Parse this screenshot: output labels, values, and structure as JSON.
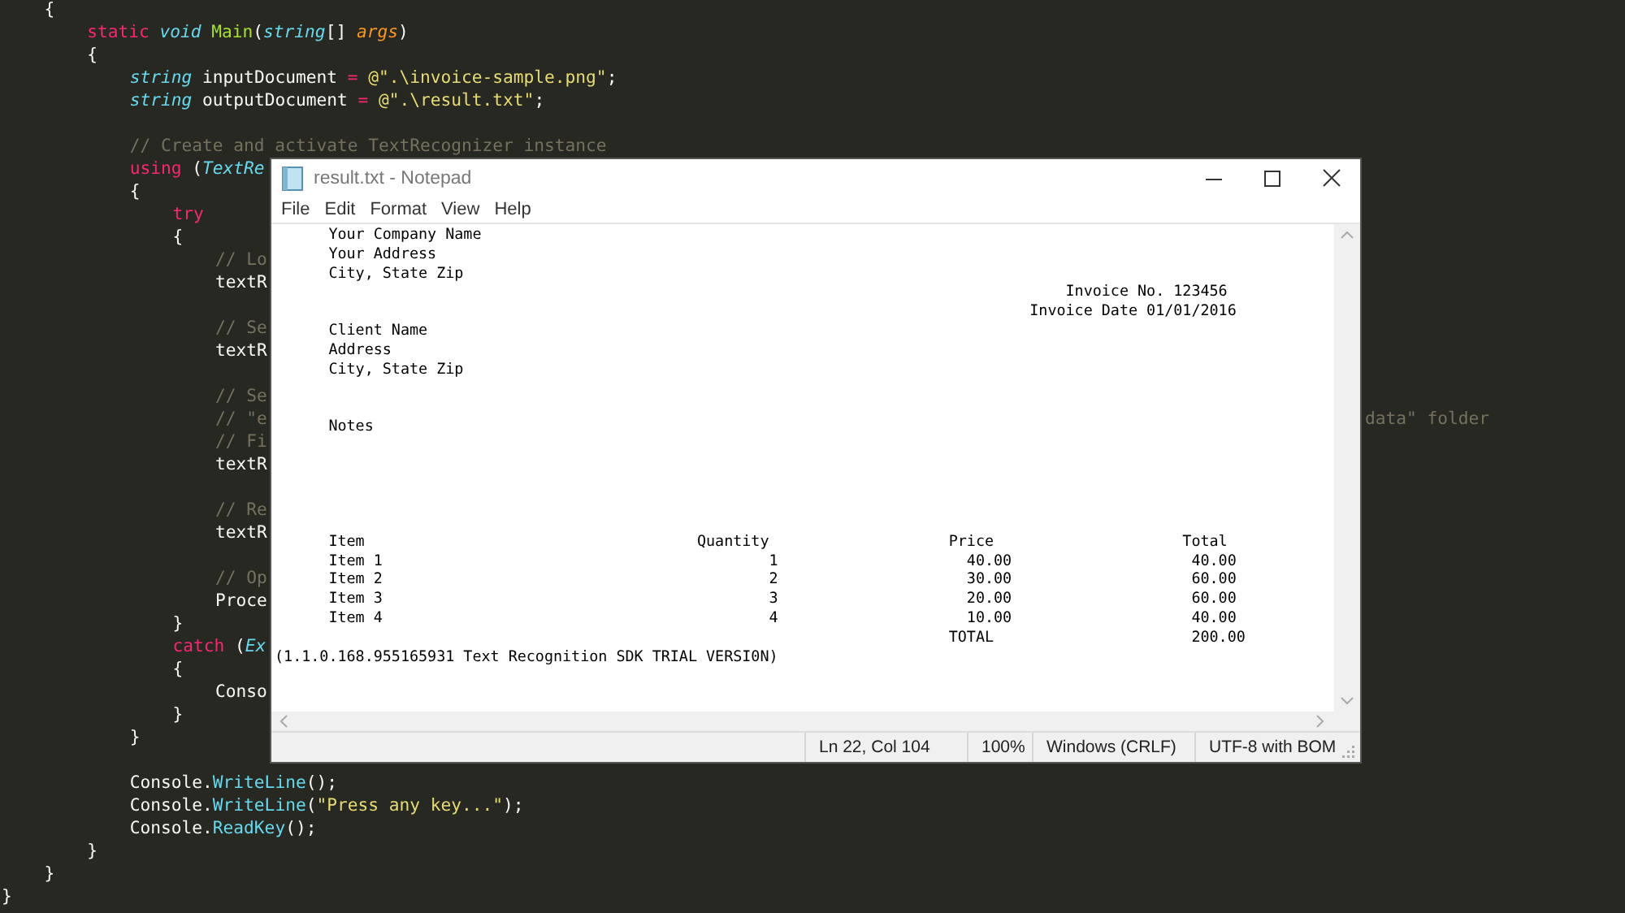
{
  "editor": {
    "lines": [
      {
        "kind": "block",
        "children": [
          {
            "kind": "code",
            "tokens": [
              {
                "kind": "plain",
                "text": "{"
              }
            ]
          },
          {
            "kind": "block",
            "children": [
              {
                "kind": "code",
                "tokens": [
                  {
                    "kind": "keyword",
                    "text": "static"
                  },
                  {
                    "kind": "type",
                    "text": " void"
                  },
                  {
                    "kind": "func",
                    "text": " Main"
                  },
                  {
                    "kind": "plain",
                    "text": "("
                  },
                  {
                    "kind": "type",
                    "text": "string"
                  },
                  {
                    "kind": "plain",
                    "text": "[] "
                  },
                  {
                    "kind": "param",
                    "text": "args"
                  },
                  {
                    "kind": "plain",
                    "text": ")"
                  }
                ]
              },
              {
                "kind": "code",
                "tokens": [
                  {
                    "kind": "plain",
                    "text": "{"
                  }
                ]
              },
              {
                "kind": "block",
                "children": [
                  {
                    "kind": "code",
                    "tokens": [
                      {
                        "kind": "type",
                        "text": "string"
                      },
                      {
                        "kind": "plain",
                        "text": " inputDocument "
                      },
                      {
                        "kind": "keyword",
                        "text": "="
                      },
                      {
                        "kind": "string",
                        "text": " @\".\\invoice-sample.png\""
                      },
                      {
                        "kind": "plain",
                        "text": ";"
                      }
                    ]
                  },
                  {
                    "kind": "code",
                    "tokens": [
                      {
                        "kind": "type",
                        "text": "string"
                      },
                      {
                        "kind": "plain",
                        "text": " outputDocument "
                      },
                      {
                        "kind": "keyword",
                        "text": "="
                      },
                      {
                        "kind": "string",
                        "text": " @\".\\result.txt\""
                      },
                      {
                        "kind": "plain",
                        "text": ";"
                      }
                    ]
                  },
                  {
                    "kind": "blank"
                  },
                  {
                    "kind": "code",
                    "tokens": [
                      {
                        "kind": "comment",
                        "text": "// Create and activate TextRecognizer instance"
                      }
                    ]
                  },
                  {
                    "kind": "code",
                    "tokens": [
                      {
                        "kind": "keyword",
                        "text": "using"
                      },
                      {
                        "kind": "plain",
                        "text": " ("
                      },
                      {
                        "kind": "type",
                        "text": "TextRe"
                      }
                    ]
                  },
                  {
                    "kind": "code",
                    "tokens": [
                      {
                        "kind": "plain",
                        "text": "{"
                      }
                    ]
                  },
                  {
                    "kind": "block",
                    "children": [
                      {
                        "kind": "code",
                        "tokens": [
                          {
                            "kind": "keyword",
                            "text": "try"
                          }
                        ]
                      },
                      {
                        "kind": "code",
                        "tokens": [
                          {
                            "kind": "plain",
                            "text": "{"
                          }
                        ]
                      },
                      {
                        "kind": "block",
                        "children": [
                          {
                            "kind": "code",
                            "tokens": [
                              {
                                "kind": "comment",
                                "text": "// Lo"
                              }
                            ]
                          },
                          {
                            "kind": "code",
                            "tokens": [
                              {
                                "kind": "plain",
                                "text": "textR"
                              }
                            ]
                          },
                          {
                            "kind": "blank"
                          },
                          {
                            "kind": "code",
                            "tokens": [
                              {
                                "kind": "comment",
                                "text": "// Se"
                              }
                            ]
                          },
                          {
                            "kind": "code",
                            "tokens": [
                              {
                                "kind": "plain",
                                "text": "textR"
                              }
                            ]
                          },
                          {
                            "kind": "blank"
                          },
                          {
                            "kind": "code",
                            "tokens": [
                              {
                                "kind": "comment",
                                "text": "// Se"
                              }
                            ]
                          },
                          {
                            "kind": "code",
                            "tokens": [
                              {
                                "kind": "comment",
                                "text": "// \"e"
                              }
                            ],
                            "tail": "data\" folder"
                          },
                          {
                            "kind": "code",
                            "tokens": [
                              {
                                "kind": "comment",
                                "text": "// Fi"
                              }
                            ]
                          },
                          {
                            "kind": "code",
                            "tokens": [
                              {
                                "kind": "plain",
                                "text": "textR"
                              }
                            ]
                          },
                          {
                            "kind": "blank"
                          },
                          {
                            "kind": "code",
                            "tokens": [
                              {
                                "kind": "comment",
                                "text": "// Re"
                              }
                            ]
                          },
                          {
                            "kind": "code",
                            "tokens": [
                              {
                                "kind": "plain",
                                "text": "textR"
                              }
                            ]
                          },
                          {
                            "kind": "blank"
                          },
                          {
                            "kind": "code",
                            "tokens": [
                              {
                                "kind": "comment",
                                "text": "// Op"
                              }
                            ]
                          },
                          {
                            "kind": "code",
                            "tokens": [
                              {
                                "kind": "plain",
                                "text": "Proce"
                              }
                            ]
                          }
                        ]
                      },
                      {
                        "kind": "code",
                        "tokens": [
                          {
                            "kind": "plain",
                            "text": "}"
                          }
                        ]
                      },
                      {
                        "kind": "code",
                        "tokens": [
                          {
                            "kind": "keyword",
                            "text": "catch"
                          },
                          {
                            "kind": "plain",
                            "text": " ("
                          },
                          {
                            "kind": "type",
                            "text": "Ex"
                          }
                        ]
                      },
                      {
                        "kind": "code",
                        "tokens": [
                          {
                            "kind": "plain",
                            "text": "{"
                          }
                        ]
                      },
                      {
                        "kind": "block",
                        "children": [
                          {
                            "kind": "code",
                            "tokens": [
                              {
                                "kind": "plain",
                                "text": "Conso"
                              }
                            ]
                          }
                        ]
                      },
                      {
                        "kind": "code",
                        "tokens": [
                          {
                            "kind": "plain",
                            "text": "}"
                          }
                        ]
                      }
                    ]
                  },
                  {
                    "kind": "code",
                    "tokens": [
                      {
                        "kind": "plain",
                        "text": "}"
                      }
                    ]
                  },
                  {
                    "kind": "blank"
                  },
                  {
                    "kind": "code",
                    "tokens": [
                      {
                        "kind": "plain",
                        "text": "Console."
                      },
                      {
                        "kind": "method",
                        "text": "WriteLine"
                      },
                      {
                        "kind": "plain",
                        "text": "();"
                      }
                    ]
                  },
                  {
                    "kind": "code",
                    "tokens": [
                      {
                        "kind": "plain",
                        "text": "Console."
                      },
                      {
                        "kind": "method",
                        "text": "WriteLine"
                      },
                      {
                        "kind": "plain",
                        "text": "("
                      },
                      {
                        "kind": "string",
                        "text": "\"Press any key...\""
                      },
                      {
                        "kind": "plain",
                        "text": ");"
                      }
                    ]
                  },
                  {
                    "kind": "code",
                    "tokens": [
                      {
                        "kind": "plain",
                        "text": "Console."
                      },
                      {
                        "kind": "method",
                        "text": "ReadKey"
                      },
                      {
                        "kind": "plain",
                        "text": "();"
                      }
                    ]
                  }
                ]
              },
              {
                "kind": "code",
                "tokens": [
                  {
                    "kind": "plain",
                    "text": "}"
                  }
                ]
              }
            ]
          },
          {
            "kind": "code",
            "tokens": [
              {
                "kind": "plain",
                "text": "}"
              }
            ]
          }
        ]
      },
      {
        "kind": "code",
        "tokens": [
          {
            "kind": "plain",
            "text": "}"
          }
        ]
      }
    ]
  },
  "notepad": {
    "title": "result.txt - Notepad",
    "menu": [
      "File",
      "Edit",
      "Format",
      "View",
      "Help"
    ],
    "lines": [
      {
        "kind": "text",
        "text": "      Your Company Name"
      },
      {
        "kind": "text",
        "text": "      Your Address"
      },
      {
        "kind": "text",
        "text": "      City, State Zip"
      },
      {
        "kind": "text",
        "text": "                                                                                        Invoice No. 123456"
      },
      {
        "kind": "text",
        "text": "                                                                                    Invoice Date 01/01/2016"
      },
      {
        "kind": "text",
        "text": "      Client Name"
      },
      {
        "kind": "text",
        "text": "      Address"
      },
      {
        "kind": "text",
        "text": "      City, State Zip"
      },
      {
        "kind": "blank"
      },
      {
        "kind": "blank"
      },
      {
        "kind": "text",
        "text": "      Notes"
      },
      {
        "kind": "blank"
      },
      {
        "kind": "blank"
      },
      {
        "kind": "blank"
      },
      {
        "kind": "blank"
      },
      {
        "kind": "blank"
      },
      {
        "kind": "text",
        "text": "      Item                                     Quantity                    Price                     Total"
      },
      {
        "kind": "text",
        "text": "      Item 1                                           1                     40.00                    40.00"
      },
      {
        "kind": "text",
        "text": "      Item 2                                           2                     30.00                    60.00"
      },
      {
        "kind": "text",
        "text": "      Item 3                                           3                     20.00                    60.00"
      },
      {
        "kind": "text",
        "text": "      Item 4                                           4                     10.00                    40.00"
      },
      {
        "kind": "text",
        "text": "                                                                           TOTAL                      200.00"
      },
      {
        "kind": "text",
        "text": "(1.1.0.168.955165931 Text Recognition SDK TRIAL VERSI0N)"
      }
    ],
    "status_bar": [
      "Ln 22, Col 104",
      "100%",
      "Windows (CRLF)",
      "UTF-8 with BOM"
    ]
  }
}
